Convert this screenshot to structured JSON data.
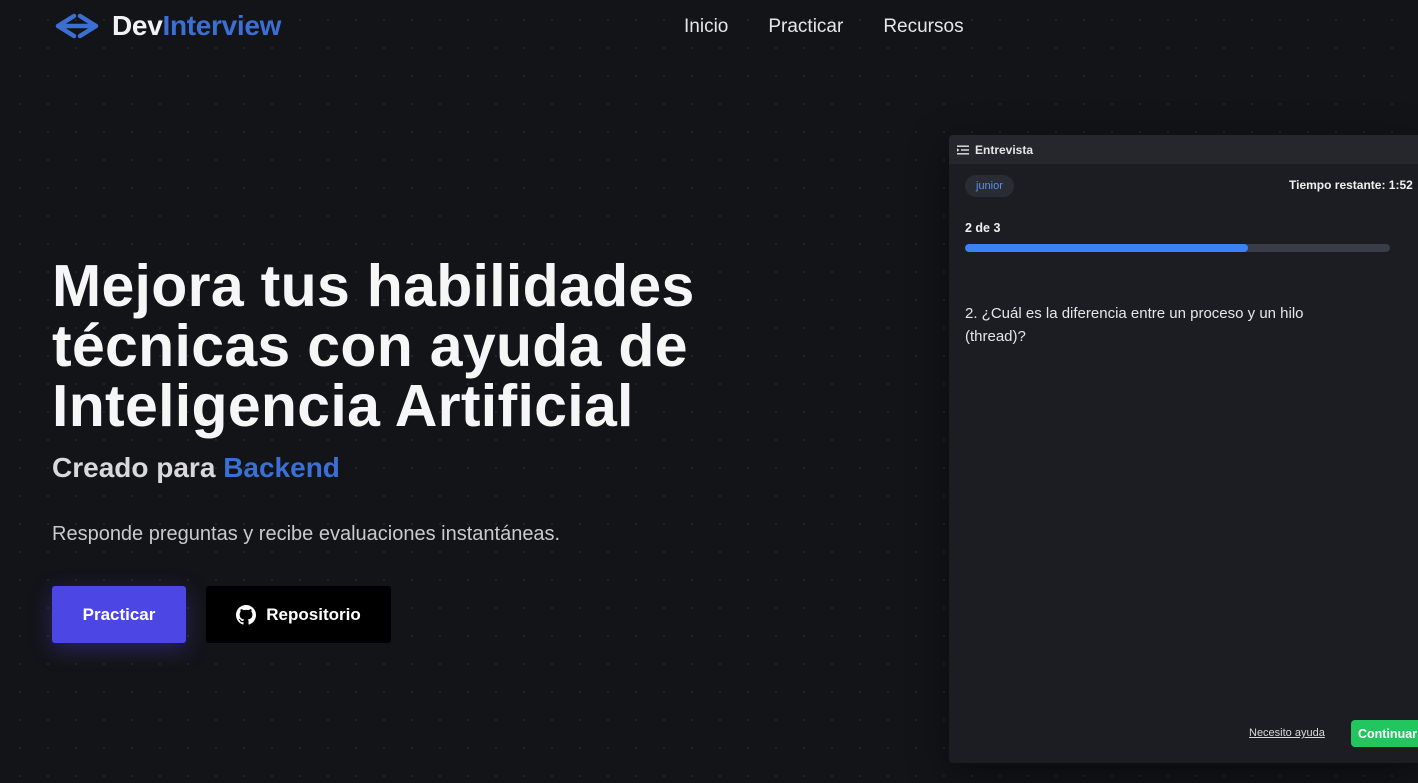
{
  "brand": {
    "name_part1": "Dev",
    "name_part2": "Interview",
    "icon": "arrows-exchange-icon",
    "accent_color": "#3b6fd4"
  },
  "nav": {
    "items": [
      {
        "label": "Inicio"
      },
      {
        "label": "Practicar"
      },
      {
        "label": "Recursos"
      }
    ]
  },
  "hero": {
    "title_lines": [
      "Mejora tus habilidades",
      "técnicas con ayuda de",
      "Inteligencia Artificial"
    ],
    "subtitle_prefix": "Creado para",
    "subtitle_highlight": "Backend",
    "description": "Responde preguntas y recibe evaluaciones instantáneas.",
    "primary_button": "Practicar",
    "repo_button": "Repositorio",
    "repo_icon": "github-icon",
    "primary_color": "#4c46e5"
  },
  "interview": {
    "header_title": "Entrevista",
    "header_icon": "list-indent-icon",
    "level_badge": "junior",
    "timer": "Tiempo restante: 1:52",
    "progress_label": "2 de 3",
    "progress_fraction": 0.667,
    "question": "2. ¿Cuál es la diferencia entre un proceso y un hilo (thread)?",
    "help_link": "Necesito ayuda",
    "continue_button": "Continuar",
    "continue_color": "#22c55e",
    "progress_color": "#3b82f6"
  }
}
